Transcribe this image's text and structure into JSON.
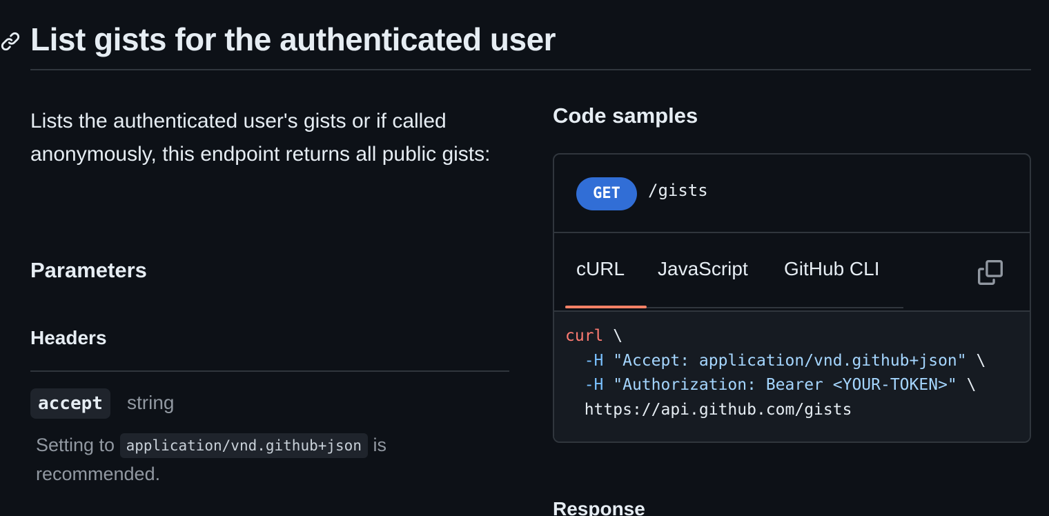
{
  "section": {
    "title": "List gists for the authenticated user",
    "anchor_icon": "link-icon"
  },
  "description": "Lists the authenticated user's gists or if called anonymously, this endpoint returns all public gists:",
  "parameters": {
    "heading": "Parameters",
    "headers_heading": "Headers",
    "items": [
      {
        "name": "accept",
        "type": "string",
        "desc_prefix": "Setting to",
        "desc_code": "application/vnd.github+json",
        "desc_suffix": "is recommended."
      }
    ]
  },
  "code_samples": {
    "heading": "Code samples",
    "method": "GET",
    "path": "/gists",
    "tabs": [
      "cURL",
      "JavaScript",
      "GitHub CLI"
    ],
    "active_tab": "cURL",
    "copy_icon": "copy-icon",
    "code": {
      "line1_cmd": "curl",
      "line1_rest": " \\",
      "line2_flag": "-H",
      "line2_str": "\"Accept: application/vnd.github+json\"",
      "line2_rest": " \\",
      "line3_flag": "-H",
      "line3_str": "\"Authorization: Bearer <YOUR-TOKEN>\"",
      "line3_rest": " \\",
      "line4": "https://api.github.com/gists"
    }
  },
  "response": {
    "heading": "Response"
  },
  "colors": {
    "background": "#0d1117",
    "method_badge": "#316ed6",
    "active_tab_underline": "#f78166",
    "code_background": "#161b22"
  }
}
